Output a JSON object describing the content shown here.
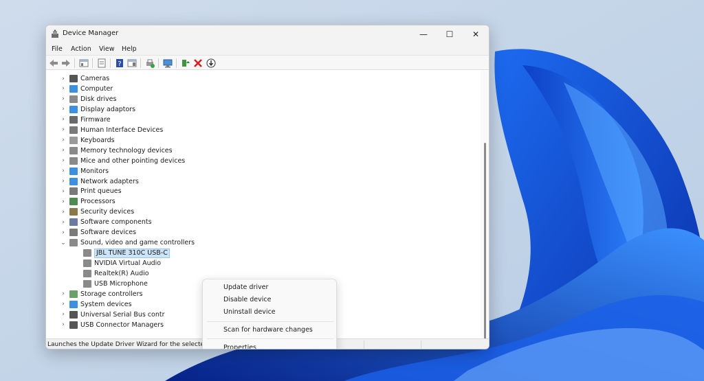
{
  "window": {
    "title": "Device Manager"
  },
  "controls": {
    "minimize": "—",
    "maximize": "☐",
    "close": "✕"
  },
  "menubar": {
    "items": [
      "File",
      "Action",
      "View",
      "Help"
    ]
  },
  "toolbar": {
    "buttons": [
      "back-icon",
      "forward-icon",
      "show-hide-console-tree-icon",
      "properties-icon",
      "help-icon",
      "action-pane-icon",
      "update-driver-icon",
      "scan-hardware-icon",
      "add-legacy-icon",
      "uninstall-icon",
      "disable-icon"
    ]
  },
  "tree": {
    "categories": [
      {
        "label": "Cameras",
        "expanded": false,
        "icon": "camera-icon"
      },
      {
        "label": "Computer",
        "expanded": false,
        "icon": "computer-icon"
      },
      {
        "label": "Disk drives",
        "expanded": false,
        "icon": "disk-icon"
      },
      {
        "label": "Display adaptors",
        "expanded": false,
        "icon": "display-icon"
      },
      {
        "label": "Firmware",
        "expanded": false,
        "icon": "firmware-icon"
      },
      {
        "label": "Human Interface Devices",
        "expanded": false,
        "icon": "hid-icon"
      },
      {
        "label": "Keyboards",
        "expanded": false,
        "icon": "keyboard-icon"
      },
      {
        "label": "Memory technology devices",
        "expanded": false,
        "icon": "memory-icon"
      },
      {
        "label": "Mice and other pointing devices",
        "expanded": false,
        "icon": "mouse-icon"
      },
      {
        "label": "Monitors",
        "expanded": false,
        "icon": "monitor-icon"
      },
      {
        "label": "Network adapters",
        "expanded": false,
        "icon": "network-icon"
      },
      {
        "label": "Print queues",
        "expanded": false,
        "icon": "printer-icon"
      },
      {
        "label": "Processors",
        "expanded": false,
        "icon": "processor-icon"
      },
      {
        "label": "Security devices",
        "expanded": false,
        "icon": "security-icon"
      },
      {
        "label": "Software components",
        "expanded": false,
        "icon": "software-component-icon"
      },
      {
        "label": "Software devices",
        "expanded": false,
        "icon": "software-device-icon"
      },
      {
        "label": "Sound, video and game controllers",
        "expanded": true,
        "icon": "speaker-icon"
      }
    ],
    "sound_children": [
      {
        "label": "JBL TUNE 310C USB-C",
        "selected": true
      },
      {
        "label": "NVIDIA Virtual Audio"
      },
      {
        "label": "Realtek(R) Audio"
      },
      {
        "label": "USB Microphone"
      }
    ],
    "after": [
      {
        "label": "Storage controllers",
        "icon": "storage-icon"
      },
      {
        "label": "System devices",
        "icon": "system-icon"
      },
      {
        "label": "Universal Serial Bus contr",
        "icon": "usb-icon"
      },
      {
        "label": "USB Connector Managers",
        "icon": "usb-icon"
      }
    ]
  },
  "context_menu": {
    "items": [
      "Update driver",
      "Disable device",
      "Uninstall device",
      "Scan for hardware changes",
      "Properties"
    ]
  },
  "status": {
    "text": "Launches the Update Driver Wizard for the selected device."
  },
  "colors": {
    "selection": "#cce4f7",
    "accent": "#0b57d0"
  }
}
